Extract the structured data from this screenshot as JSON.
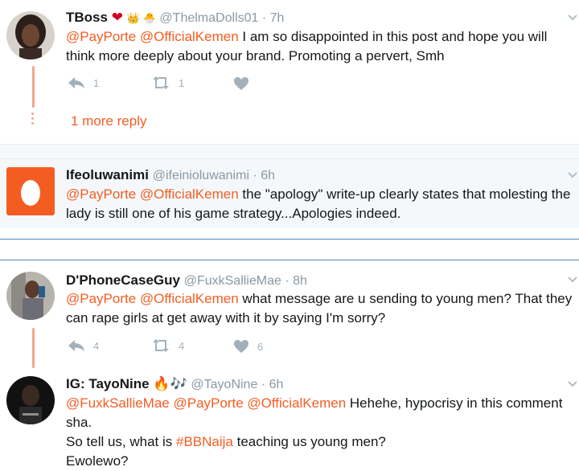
{
  "tweets": [
    {
      "name": "TBoss",
      "emoji": "❤",
      "emoji2": "👑 🐣",
      "handle": "@ThelmaDolls01 · 7h",
      "mentions": "@PayPorte @OfficialKemen",
      "body": " I am so disappointed in this post and hope you will think more deeply about your brand. Promoting a pervert, Smh",
      "reply_count": "1",
      "retweet_count": "1",
      "like_count": "",
      "more_replies": "1 more reply"
    },
    {
      "name": "Ifeoluwanimi",
      "handle": "@ifeinioluwanimi · 6h",
      "mentions": "@PayPorte @OfficialKemen",
      "body": " the \"apology\" write-up clearly states that molesting the lady is still one of his game strategy...Apologies indeed."
    },
    {
      "name": "D'PhoneCaseGuy",
      "handle": "@FuxkSallieMae · 8h",
      "mentions": "@PayPorte @OfficialKemen",
      "body": " what message are u sending to young men? That they can rape girls at get away with it by saying I'm sorry?",
      "reply_count": "4",
      "retweet_count": "4",
      "like_count": "6"
    },
    {
      "name": "IG: TayoNine",
      "emoji": "🔥🎶",
      "handle": "@TayoNine · 6h",
      "mentions": "@FuxkSallieMae @PayPorte @OfficialKemen",
      "body": " Hehehe, hypocrisy in this comment sha.",
      "line2_pre": "So tell us, what is ",
      "hashtag": "#BBNaija",
      "line2_post": " teaching us young men?",
      "line3": "Ewolewo?"
    }
  ],
  "colors": {
    "accent": "#f45d22",
    "muted": "#8b98a3",
    "icon": "#a3b0ba",
    "thread": "#f6a58a"
  },
  "icons": [
    "reply-icon",
    "retweet-icon",
    "like-icon",
    "chevron-down-icon",
    "egg-avatar-icon"
  ]
}
